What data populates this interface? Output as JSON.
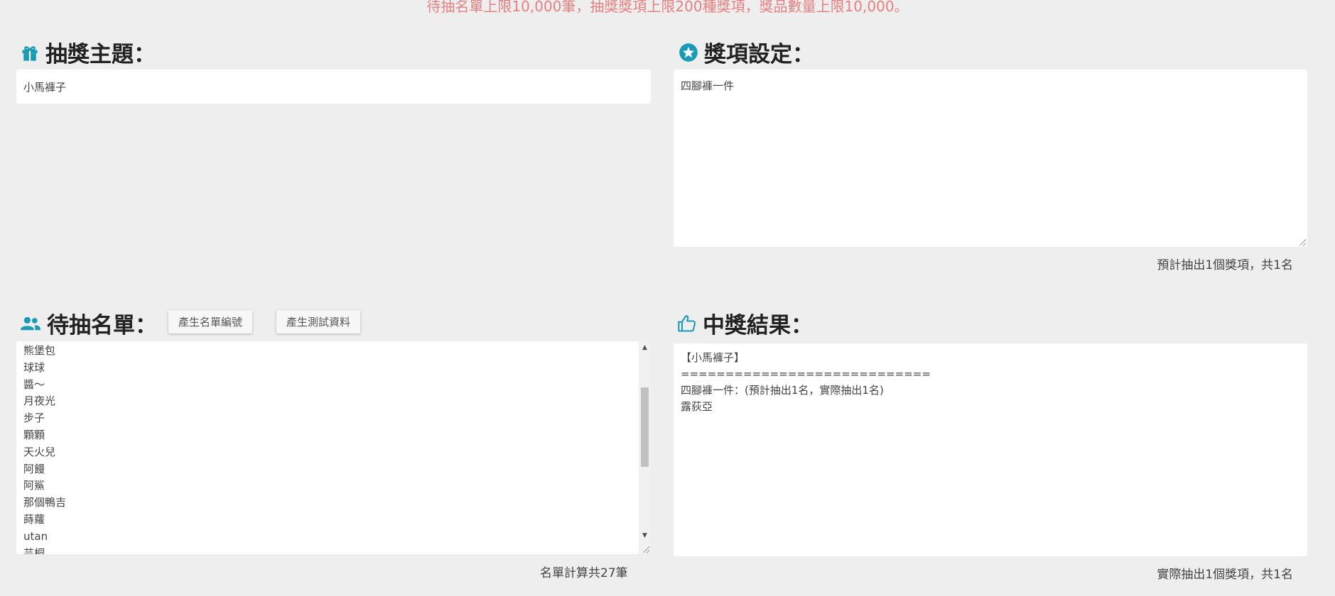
{
  "notice": "待抽名單上限10,000筆，抽獎獎項上限200種獎項，獎品數量上限10,000。",
  "theme": {
    "title": "抽獎主題：",
    "value": "小馬褲子"
  },
  "prize": {
    "title": "獎項設定：",
    "value": "四腳褲一件",
    "summary": "預計抽出1個獎項，共1名"
  },
  "names": {
    "title": "待抽名單：",
    "generate_ids_label": "產生名單編號",
    "generate_test_label": "產生測試資料",
    "items": [
      "熊堡包",
      "球球",
      "醬～",
      "月夜光",
      "步子",
      "顆顆",
      "天火兒",
      "阿饅",
      "阿鯊",
      "那個鴨吉",
      "蒔蘿",
      "utan",
      "芸桐"
    ],
    "count_text": "名單計算共27筆"
  },
  "result": {
    "title": "中獎結果：",
    "lines": [
      "【小馬褲子】",
      "============================",
      "四腳褲一件：(預計抽出1名，實際抽出1名)",
      "露荻亞"
    ],
    "summary": "實際抽出1個獎項，共1名"
  },
  "colors": {
    "accent": "#1a9bb5",
    "notice": "#e88080",
    "background": "#eeeeee"
  },
  "icons": {
    "theme": "gift-icon",
    "prize": "star-circle-icon",
    "names": "users-icon",
    "result": "thumbs-up-icon"
  }
}
